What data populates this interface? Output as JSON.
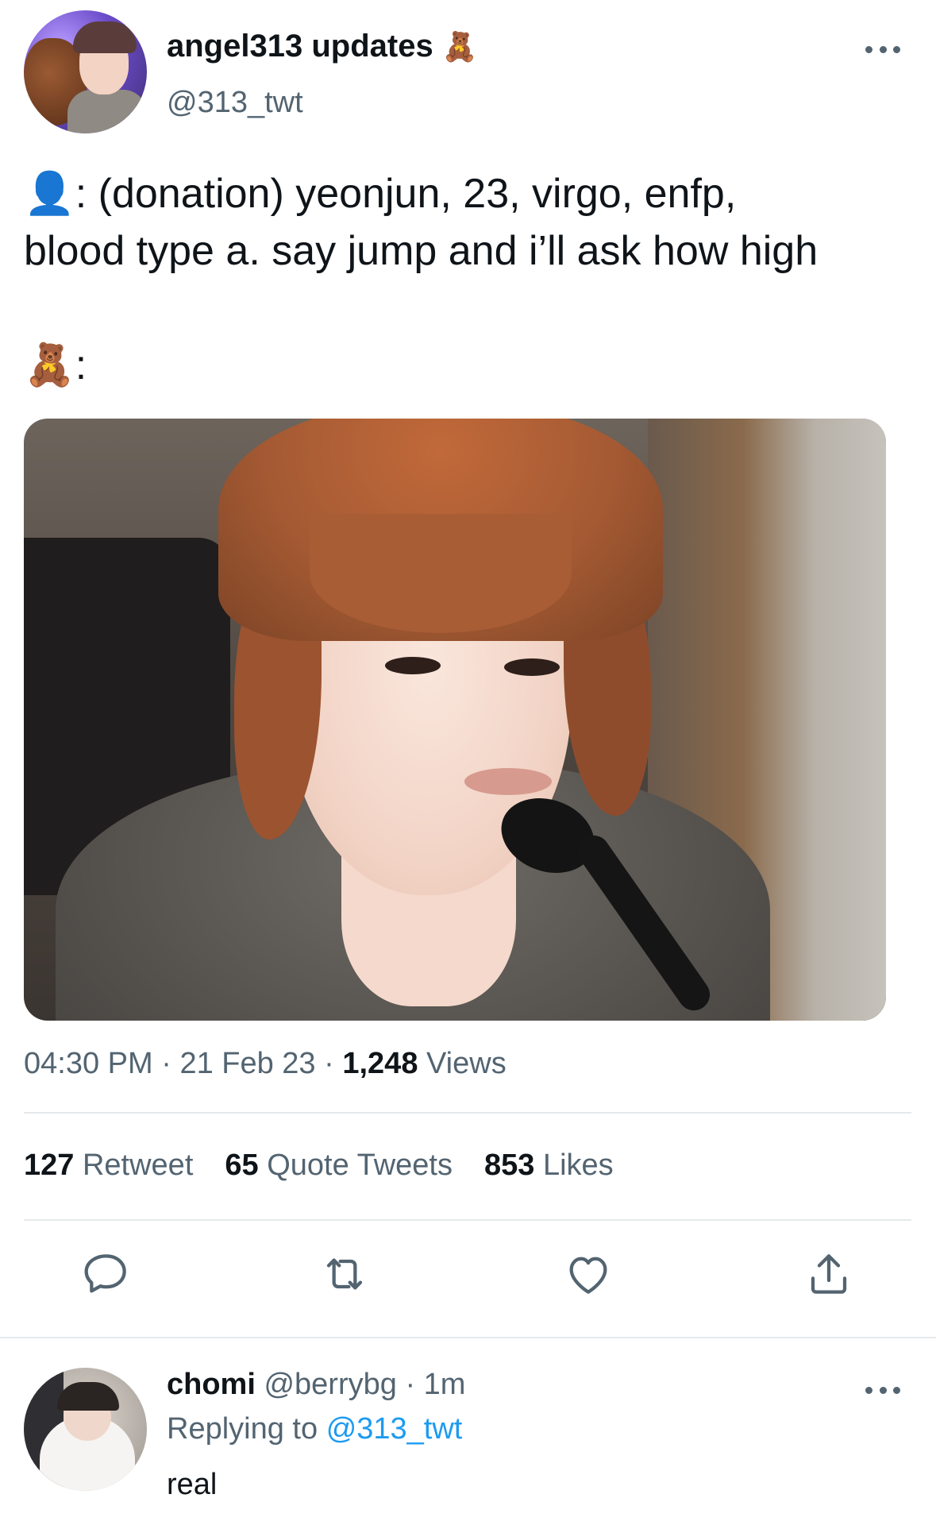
{
  "tweet": {
    "display_name": "angel313 updates",
    "name_emoji": "🧸",
    "handle": "@313_twt",
    "text_line1": "👤: (donation) yeonjun, 23, virgo, enfp,",
    "text_line2": "blood type a. say jump and i’ll ask how high",
    "text_line3": "🧸:",
    "time": "04:30 PM",
    "date": "21 Feb 23",
    "views_count": "1,248",
    "views_label": "Views",
    "separator": "·"
  },
  "stats": {
    "retweets_count": "127",
    "retweets_label": "Retweet",
    "quotes_count": "65",
    "quotes_label": "Quote Tweets",
    "likes_count": "853",
    "likes_label": "Likes"
  },
  "actions": {
    "icons": [
      "reply-icon",
      "retweet-icon",
      "like-icon",
      "share-icon"
    ]
  },
  "reply": {
    "name": "chomi",
    "handle": "@berrybg",
    "separator": "·",
    "time": "1m",
    "replying_prefix": "Replying to",
    "replying_to": "@313_twt",
    "text": "real"
  },
  "colors": {
    "text_primary": "#0f1419",
    "text_secondary": "#536471",
    "link": "#1d9bf0",
    "divider": "#e6e9eb"
  }
}
